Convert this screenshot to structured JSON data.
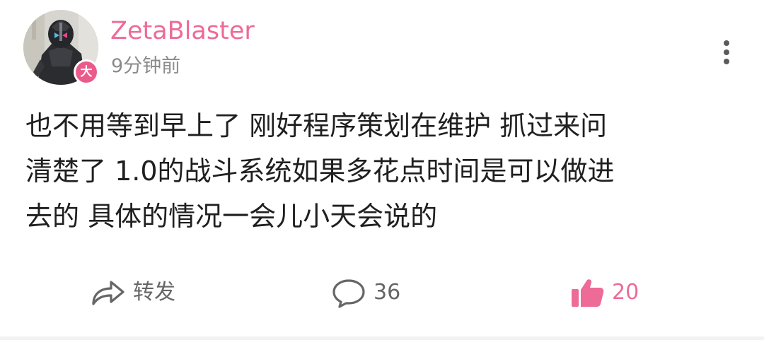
{
  "post": {
    "author": {
      "name": "ZetaBlaster",
      "avatar_icon": "armored-hero-avatar",
      "level_badge": "大"
    },
    "timestamp": "9分钟前",
    "content_lines": [
      "也不用等到早上了 刚好程序策划在维护 抓过来问",
      "清楚了 1.0的战斗系统如果多花点时间是可以做进",
      "去的 具体的情况一会儿小天会说的"
    ],
    "actions": {
      "repost": {
        "icon": "share-arrow-icon",
        "label": "转发"
      },
      "comment": {
        "icon": "comment-bubble-icon",
        "count": "36"
      },
      "like": {
        "icon": "thumbs-up-icon",
        "count": "20"
      }
    },
    "menu_icon": "more-vertical-icon"
  },
  "colors": {
    "author_name": "#ee6a97",
    "like_accent": "#ee6a97",
    "badge": "#ea5a8a",
    "secondary_text": "#8b8b8b",
    "body_text": "#1f1f1f"
  }
}
